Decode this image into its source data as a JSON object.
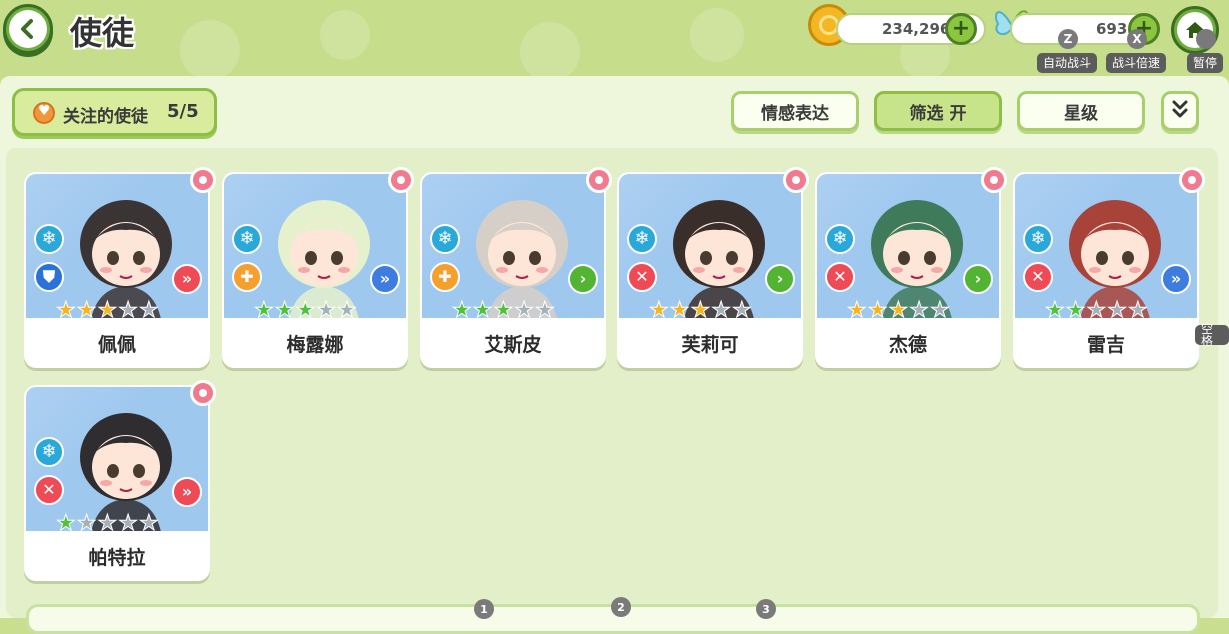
{
  "header": {
    "title": "使徒",
    "gold": "234,296",
    "gems": "693"
  },
  "hotkeys": [
    {
      "key": "Z",
      "label": "自动战斗"
    },
    {
      "key": "X",
      "label": "战斗倍速"
    },
    {
      "key": "",
      "label": "暂停"
    }
  ],
  "side_hint": "空格",
  "focus": {
    "label": "关注的使徒",
    "count": "5/5"
  },
  "filters": [
    {
      "label": "情感表达"
    },
    {
      "label": "筛选 开"
    },
    {
      "label": "星级"
    }
  ],
  "characters": [
    {
      "name": "佩佩",
      "stars": 3,
      "star_color": "gold",
      "role": "shield",
      "role_color": "#2b72d8",
      "range_color": "#ee4b57",
      "hair": "#3b3434",
      "icon_names": [
        "ice-icon",
        "shield-icon",
        "double-chevron-icon"
      ]
    },
    {
      "name": "梅露娜",
      "stars": 3,
      "star_color": "green",
      "role": "heal",
      "role_color": "#f5a02c",
      "range_color": "#3e7de0",
      "hair": "#e5f1cc",
      "icon_names": [
        "ice-icon",
        "heal-cross-icon",
        "double-chevron-icon"
      ]
    },
    {
      "name": "艾斯皮",
      "stars": 3,
      "star_color": "green",
      "role": "heal",
      "role_color": "#f5a02c",
      "range_color": "#53b332",
      "hair": "#d6cfc8",
      "icon_names": [
        "ice-icon",
        "heal-cross-icon",
        "chevron-icon"
      ]
    },
    {
      "name": "芙莉可",
      "stars": 3,
      "star_color": "gold",
      "role": "attack",
      "role_color": "#ee4b57",
      "range_color": "#53b332",
      "hair": "#3a2e2a",
      "icon_names": [
        "ice-icon",
        "swords-icon",
        "chevron-icon"
      ]
    },
    {
      "name": "杰德",
      "stars": 3,
      "star_color": "gold",
      "role": "attack",
      "role_color": "#ee4b57",
      "range_color": "#53b332",
      "hair": "#3f7a5a",
      "icon_names": [
        "ice-icon",
        "swords-icon",
        "chevron-icon"
      ]
    },
    {
      "name": "雷吉",
      "stars": 2,
      "star_color": "green",
      "role": "attack",
      "role_color": "#ee4b57",
      "range_color": "#3e7de0",
      "hair": "#a8433a",
      "icon_names": [
        "ice-icon",
        "swords-icon",
        "double-chevron-icon"
      ]
    },
    {
      "name": "帕特拉",
      "stars": 1,
      "star_color": "green",
      "role": "attack",
      "role_color": "#ee4b57",
      "range_color": "#ee4b57",
      "hair": "#2f2d30",
      "icon_names": [
        "ice-icon",
        "swords-icon",
        "double-chevron-icon"
      ]
    }
  ],
  "bottom_badges": [
    "1",
    "2",
    "3"
  ]
}
